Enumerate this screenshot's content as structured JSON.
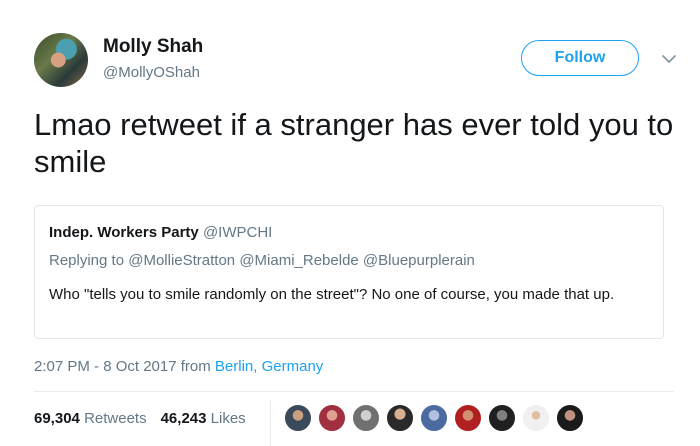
{
  "author": {
    "name": "Molly Shah",
    "handle": "@MollyOShah"
  },
  "follow_label": "Follow",
  "tweet_text": "Lmao retweet if a stranger has ever told you to smile",
  "quoted": {
    "name": "Indep. Workers Party",
    "handle": "@IWPCHI",
    "replying_prefix": "Replying to",
    "mentions": "@MollieStratton @Miami_Rebelde @Bluepurplerain",
    "text": "Who \"tells you to smile randomly on the street\"? No one of course, you made that up."
  },
  "meta": {
    "timestamp": "2:07 PM - 8 Oct 2017",
    "from": "from",
    "location": "Berlin, Germany"
  },
  "stats": {
    "retweets_count": "69,304",
    "retweets_label": "Retweets",
    "likes_count": "46,243",
    "likes_label": "Likes"
  },
  "icons": {
    "chevron": "chevron-down-icon"
  },
  "colors": {
    "accent": "#1da1f2",
    "secondary_text": "#657786",
    "primary_text": "#14171a",
    "border": "#e1e8ed"
  }
}
